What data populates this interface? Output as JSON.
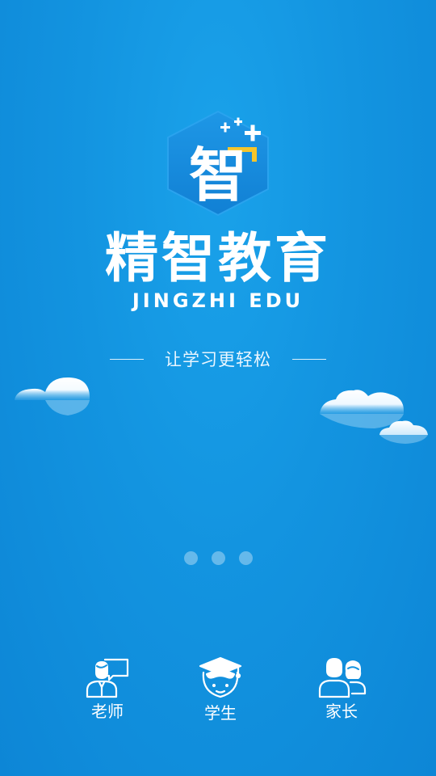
{
  "brand": {
    "logo_char": "智",
    "title": "精智教育",
    "subtitle": "JINGZHI EDU",
    "slogan": "让学习更轻松"
  },
  "pager": {
    "count": 3,
    "active_index": null
  },
  "roles": [
    {
      "label": "老师",
      "icon": "teacher-icon"
    },
    {
      "label": "学生",
      "icon": "student-icon"
    },
    {
      "label": "家长",
      "icon": "parent-icon"
    }
  ],
  "colors": {
    "background": "#1394e0",
    "logo_badge": "#1a8be0",
    "logo_accent": "#f6c52b",
    "text": "#ffffff"
  }
}
